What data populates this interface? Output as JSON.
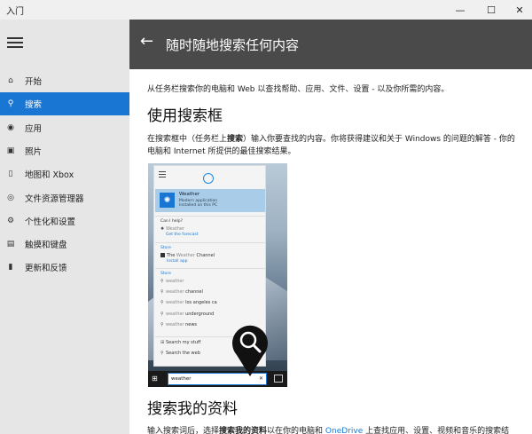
{
  "window": {
    "title": "入门",
    "minimize_glyph": "—",
    "maximize_glyph": "☐",
    "close_glyph": "✕"
  },
  "sidebar": {
    "items": [
      {
        "label": "开始",
        "icon": "⌂",
        "icon_name": "home-icon",
        "active": false
      },
      {
        "label": "搜索",
        "icon": "⚲",
        "icon_name": "search-icon",
        "active": true
      },
      {
        "label": "应用",
        "icon": "◉",
        "icon_name": "apps-icon",
        "active": false
      },
      {
        "label": "照片",
        "icon": "▣",
        "icon_name": "photos-icon",
        "active": false
      },
      {
        "label": "地图和 Xbox",
        "icon": "▯",
        "icon_name": "xbox-icon",
        "active": false
      },
      {
        "label": "文件资源管理器",
        "icon": "◎",
        "icon_name": "file-explorer-icon",
        "active": false
      },
      {
        "label": "个性化和设置",
        "icon": "⚙",
        "icon_name": "settings-icon",
        "active": false
      },
      {
        "label": "触摸和键盘",
        "icon": "▤",
        "icon_name": "keyboard-icon",
        "active": false
      },
      {
        "label": "更新和反馈",
        "icon": "▮",
        "icon_name": "feedback-icon",
        "active": false
      }
    ]
  },
  "header": {
    "back_glyph": "←",
    "title": "随时随地搜索任何内容"
  },
  "content": {
    "intro": "从任务栏搜索你的电脑和 Web 以查找帮助、应用、文件、设置 - 以及你所需的内容。",
    "section1_title": "使用搜索框",
    "section1_para_a": "在搜索框中（任务栏上",
    "section1_para_bold": "搜索",
    "section1_para_b": "）输入你要查找的内容。你将获得建议和关于 Windows 的问题的解答 - 你的电脑和 Internet 所提供的最佳搜索结果。",
    "section2_title": "搜索我的资料",
    "section2_para_a": "输入搜索词后，选择",
    "section2_para_bold": "搜索我的资料",
    "section2_para_b": "以在你的电脑和 ",
    "section2_link": "OneDrive",
    "section2_para_c": " 上查找应用、设置、视频和音乐的搜索结"
  },
  "illustration": {
    "weather_title": "Weather",
    "weather_sub1": "Modern application",
    "weather_sub2": "Installed on this PC",
    "help_heading": "Can I help?",
    "help_item": "Weather",
    "help_link": "Get the forecast",
    "store_heading1": "Store",
    "store_item_prefix": "The ",
    "store_item_mid": "Weather",
    "store_item_suffix": " Channel",
    "store_link": "Install app",
    "store_heading2": "Store",
    "suggestions": [
      {
        "gray": "weather",
        "rest": ""
      },
      {
        "gray": "weather",
        "rest": " channel"
      },
      {
        "gray": "weather",
        "rest": " los angeles ca"
      },
      {
        "gray": "weather",
        "rest": " underground"
      },
      {
        "gray": "weather",
        "rest": " news"
      }
    ],
    "search_my_stuff": "Search my stuff",
    "search_web": "Search the web",
    "search_value": "weather",
    "clear_glyph": "✕"
  }
}
